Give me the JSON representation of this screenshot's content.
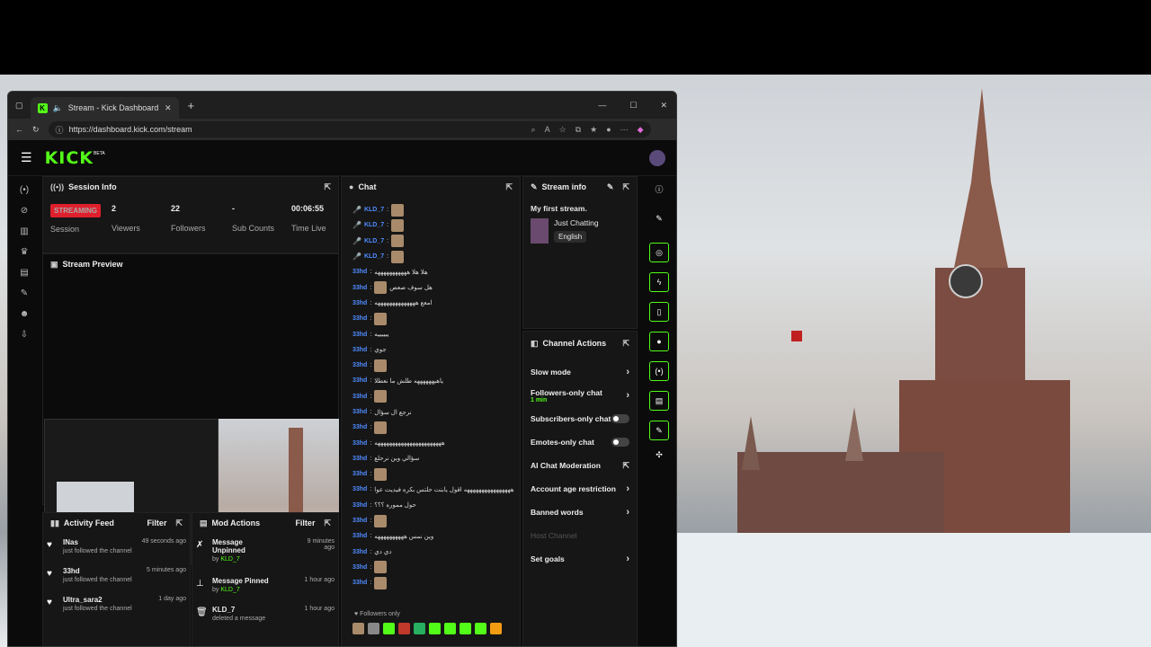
{
  "browser": {
    "tab_title": "Stream - Kick Dashboard",
    "url": "https://dashboard.kick.com/stream",
    "favicon": "K"
  },
  "app": {
    "logo": "KICK",
    "logo_badge": "BETA"
  },
  "session": {
    "title": "Session Info",
    "status_badge": "STREAMING",
    "session_label": "Session",
    "viewers_value": "2",
    "viewers_label": "Viewers",
    "followers_value": "22",
    "followers_label": "Followers",
    "subs_value": "-",
    "subs_label": "Sub Counts",
    "time_value": "00:06:55",
    "time_label": "Time Live"
  },
  "preview": {
    "title": "Stream Preview"
  },
  "chat": {
    "title": "Chat",
    "followers_only": "Followers only",
    "messages": [
      {
        "user": "KLD_7",
        "text": "",
        "kind": "mod"
      },
      {
        "user": "KLD_7",
        "text": "",
        "kind": "mod"
      },
      {
        "user": "KLD_7",
        "text": "",
        "kind": "mod"
      },
      {
        "user": "KLD_7",
        "text": "",
        "kind": "mod"
      },
      {
        "user": "33hd",
        "text": "هلا هلا هههههههههههه",
        "kind": "txt"
      },
      {
        "user": "33hd",
        "text": "هل سوف صعص",
        "kind": "emo"
      },
      {
        "user": "33hd",
        "text": "امعع ههههههههههههههه",
        "kind": "txt"
      },
      {
        "user": "33hd",
        "text": "",
        "kind": "emo"
      },
      {
        "user": "33hd",
        "text": "ييييييه",
        "kind": "txt"
      },
      {
        "user": "33hd",
        "text": "جوي",
        "kind": "txt"
      },
      {
        "user": "33hd",
        "text": "",
        "kind": "emo"
      },
      {
        "user": "33hd",
        "text": "ياهيههههههه طلش ما نعطلا",
        "kind": "txt"
      },
      {
        "user": "33hd",
        "text": "",
        "kind": "emo"
      },
      {
        "user": "33hd",
        "text": "نرجع ال سؤال",
        "kind": "txt"
      },
      {
        "user": "33hd",
        "text": "",
        "kind": "emo"
      },
      {
        "user": "33hd",
        "text": "هههههههههههههههههههههههه",
        "kind": "txt"
      },
      {
        "user": "33hd",
        "text": "سؤالي وين نرحلع",
        "kind": "txt"
      },
      {
        "user": "33hd",
        "text": "",
        "kind": "emo"
      },
      {
        "user": "33hd",
        "text": "ههههههههههههههههه اقول يابنت حلتس بكره فيديت عوا",
        "kind": "txt"
      },
      {
        "user": "33hd",
        "text": "حول مموره ؟؟؟",
        "kind": "txt"
      },
      {
        "user": "33hd",
        "text": "",
        "kind": "emo"
      },
      {
        "user": "33hd",
        "text": "وين نمس ههههههههههه",
        "kind": "txt"
      },
      {
        "user": "33hd",
        "text": "دي دي",
        "kind": "txt"
      },
      {
        "user": "33hd",
        "text": "",
        "kind": "emo"
      },
      {
        "user": "33hd",
        "text": "",
        "kind": "emo"
      }
    ]
  },
  "stream_info": {
    "title": "Stream info",
    "stream_title": "My first stream.",
    "category": "Just Chatting",
    "language": "English"
  },
  "channel_actions": {
    "title": "Channel Actions",
    "items": [
      {
        "label": "Slow mode",
        "type": "chevron"
      },
      {
        "label": "Followers-only chat",
        "sub": "1 min",
        "type": "chevron"
      },
      {
        "label": "Subscribers-only chat",
        "type": "toggle"
      },
      {
        "label": "Emotes-only chat",
        "type": "toggle"
      },
      {
        "label": "AI Chat Moderation",
        "type": "link"
      },
      {
        "label": "Account age restriction",
        "type": "chevron"
      },
      {
        "label": "Banned words",
        "type": "chevron"
      },
      {
        "label": "Host Channel",
        "type": "disabled"
      },
      {
        "label": "Set goals",
        "type": "chevron"
      }
    ]
  },
  "activity": {
    "title": "Activity Feed",
    "filter": "Filter",
    "items": [
      {
        "name": "INas",
        "desc": "just followed the channel",
        "time": "49 seconds ago"
      },
      {
        "name": "33hd",
        "desc": "just followed the channel",
        "time": "5 minutes ago"
      },
      {
        "name": "Ultra_sara2",
        "desc": "just followed the channel",
        "time": "1 day ago"
      }
    ]
  },
  "mod_actions": {
    "title": "Mod Actions",
    "filter": "Filter",
    "items": [
      {
        "action": "Message Unpinned",
        "by": "by",
        "user": "KLD_7",
        "time": "9 minutes ago"
      },
      {
        "action": "Message Pinned",
        "by": "by",
        "user": "KLD_7",
        "time": "1 hour ago"
      },
      {
        "action": "KLD_7",
        "by": "deleted a message",
        "user": "",
        "time": "1 hour ago"
      }
    ]
  },
  "colors": {
    "brand": "#53fc18",
    "streaming": "#e01f2c",
    "username": "#4f8cff"
  }
}
